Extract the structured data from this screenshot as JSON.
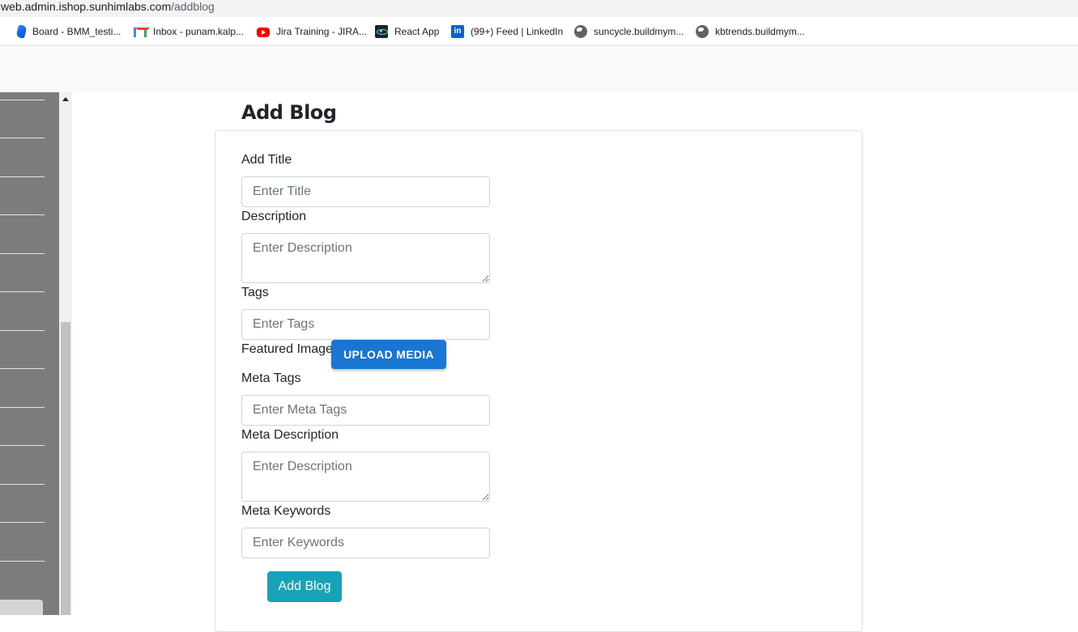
{
  "browser": {
    "url_host": "web.admin.ishop.sunhimlabs.com",
    "url_path": "/addblog"
  },
  "bookmarks": [
    {
      "label": "Board - BMM_testi...",
      "icon": "board-icon"
    },
    {
      "label": "Inbox - punam.kalp...",
      "icon": "gmail-icon"
    },
    {
      "label": "Jira Training - JIRA...",
      "icon": "youtube-icon"
    },
    {
      "label": "React App",
      "icon": "react-icon"
    },
    {
      "label": "(99+) Feed | LinkedIn",
      "icon": "linkedin-icon"
    },
    {
      "label": "suncycle.buildmym...",
      "icon": "globe-icon"
    },
    {
      "label": "kbtrends.buildmym...",
      "icon": "globe-icon"
    }
  ],
  "page": {
    "title": "Add Blog"
  },
  "form": {
    "title_label": "Add Title",
    "title_placeholder": "Enter Title",
    "description_label": "Description",
    "description_placeholder": "Enter Description",
    "tags_label": "Tags",
    "tags_placeholder": "Enter Tags",
    "featured_image_label": "Featured Image",
    "upload_button": "UPLOAD MEDIA",
    "meta_tags_label": "Meta Tags",
    "meta_tags_placeholder": "Enter Meta Tags",
    "meta_description_label": "Meta Description",
    "meta_description_placeholder": "Enter Description",
    "meta_keywords_label": "Meta Keywords",
    "meta_keywords_placeholder": "Enter Keywords",
    "submit_button": "Add Blog"
  },
  "colors": {
    "sidebar": "#7d7b7b",
    "upload_button": "#1976d2",
    "submit_button": "#17a2b8"
  }
}
